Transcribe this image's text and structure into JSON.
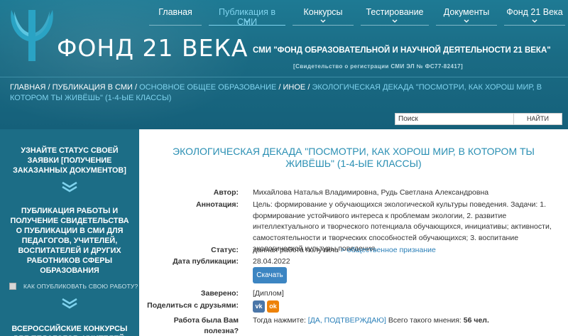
{
  "brand": {
    "logo_text": "ФОНД 21 ВЕКА",
    "primary": "#1a6b84",
    "accent": "#7fd3ee",
    "link": "#2a8fb3"
  },
  "nav": [
    {
      "label": "Главная",
      "active": false
    },
    {
      "label": "Публикация в СМИ",
      "active": true
    },
    {
      "label": "Конкурсы",
      "active": false
    },
    {
      "label": "Тестирование",
      "active": false
    },
    {
      "label": "Документы",
      "active": false
    },
    {
      "label": "Фонд 21 Века",
      "active": false
    }
  ],
  "header": {
    "smi_title": "СМИ \"ФОНД ОБРАЗОВАТЕЛЬНОЙ И НАУЧНОЙ ДЕЯТЕЛЬНОСТИ 21 ВЕКА\"",
    "certificate": "[Свидетельство о регистрации СМИ ЭЛ № ФС77-82417]"
  },
  "breadcrumb": {
    "home": "ГЛАВНАЯ",
    "publication": "ПУБЛИКАЦИЯ В СМИ",
    "section": "ОСНОВНОЕ ОБЩЕЕ ОБРАЗОВАНИЕ",
    "other": "ИНОЕ",
    "current": "ЭКОЛОГИЧЕСКАЯ ДЕКАДА \"ПОСМОТРИ, КАК ХОРОШ МИР, В КОТОРОМ ТЫ ЖИВЁШЬ\" (1-4-ЫЕ КЛАССЫ)",
    "sep": " / "
  },
  "search": {
    "value": "Поиск",
    "button": "НАЙТИ"
  },
  "sidebar": {
    "status_link": "УЗНАЙТЕ СТАТУС СВОЕЙ ЗАЯВКИ [ПОЛУЧЕНИЕ ЗАКАЗАННЫХ ДОКУМЕНТОВ]",
    "publication_link": "ПУБЛИКАЦИЯ РАБОТЫ И ПОЛУЧЕНИЕ СВИДЕТЕЛЬСТВА О ПУБЛИКАЦИИ В СМИ ДЛЯ ПЕДАГОГОВ, УЧИТЕЛЕЙ, ВОСПИТАТЕЛЕЙ И ДРУГИХ РАБОТНИКОВ СФЕРЫ ОБРАЗОВАНИЯ",
    "how_to_publish": "КАК ОПУБЛИКОВАТЬ СВОЮ РАБОТУ?",
    "contests_link": "ВСЕРОССИЙСКИЕ КОНКУРСЫ ДЛЯ ПЕДАГОГОВ, УЧИТЕЛЕЙ,"
  },
  "article": {
    "title": "ЭКОЛОГИЧЕСКАЯ ДЕКАДА \"ПОСМОТРИ, КАК ХОРОШ МИР, В КОТОРОМ ТЫ ЖИВЁШЬ\" (1-4-ЫЕ КЛАССЫ)",
    "author_label": "Автор:",
    "author": "Михайлова Наталья Владимировна, Рудь Светлана Александровна",
    "annotation_label": "Аннотация:",
    "annotation": "Цель: формирование у обучающихся экологической культуры поведения. Задачи: 1. формирование устойчивого интереса к проблемам экологии, 2. развитие интеллектуального и творческого потенциала обучающихся, инициативы; активности, самостоятельности и творческих способностей обучающихся; 3. воспитание экологической культуры поведения.",
    "status_label": "Статус:",
    "status_text": "данная работа получила ",
    "status_link": "> общественное признание",
    "date_label": "Дата публикации:",
    "date": "28.04.2022",
    "download": "Скачать",
    "verified_label": "Заверено:",
    "verified": "[Диплом]",
    "share_label": "Поделиться с друзьями:",
    "share_vk": "vk",
    "share_ok": "ok",
    "useful_label": "Работа была Вам полезна?",
    "useful_prefix": "Тогда нажмите: ",
    "useful_link": "[ДА, ПОДТВЕРЖДАЮ]",
    "useful_count_text": " Всего такого мнения: ",
    "useful_count": "56 чел."
  }
}
